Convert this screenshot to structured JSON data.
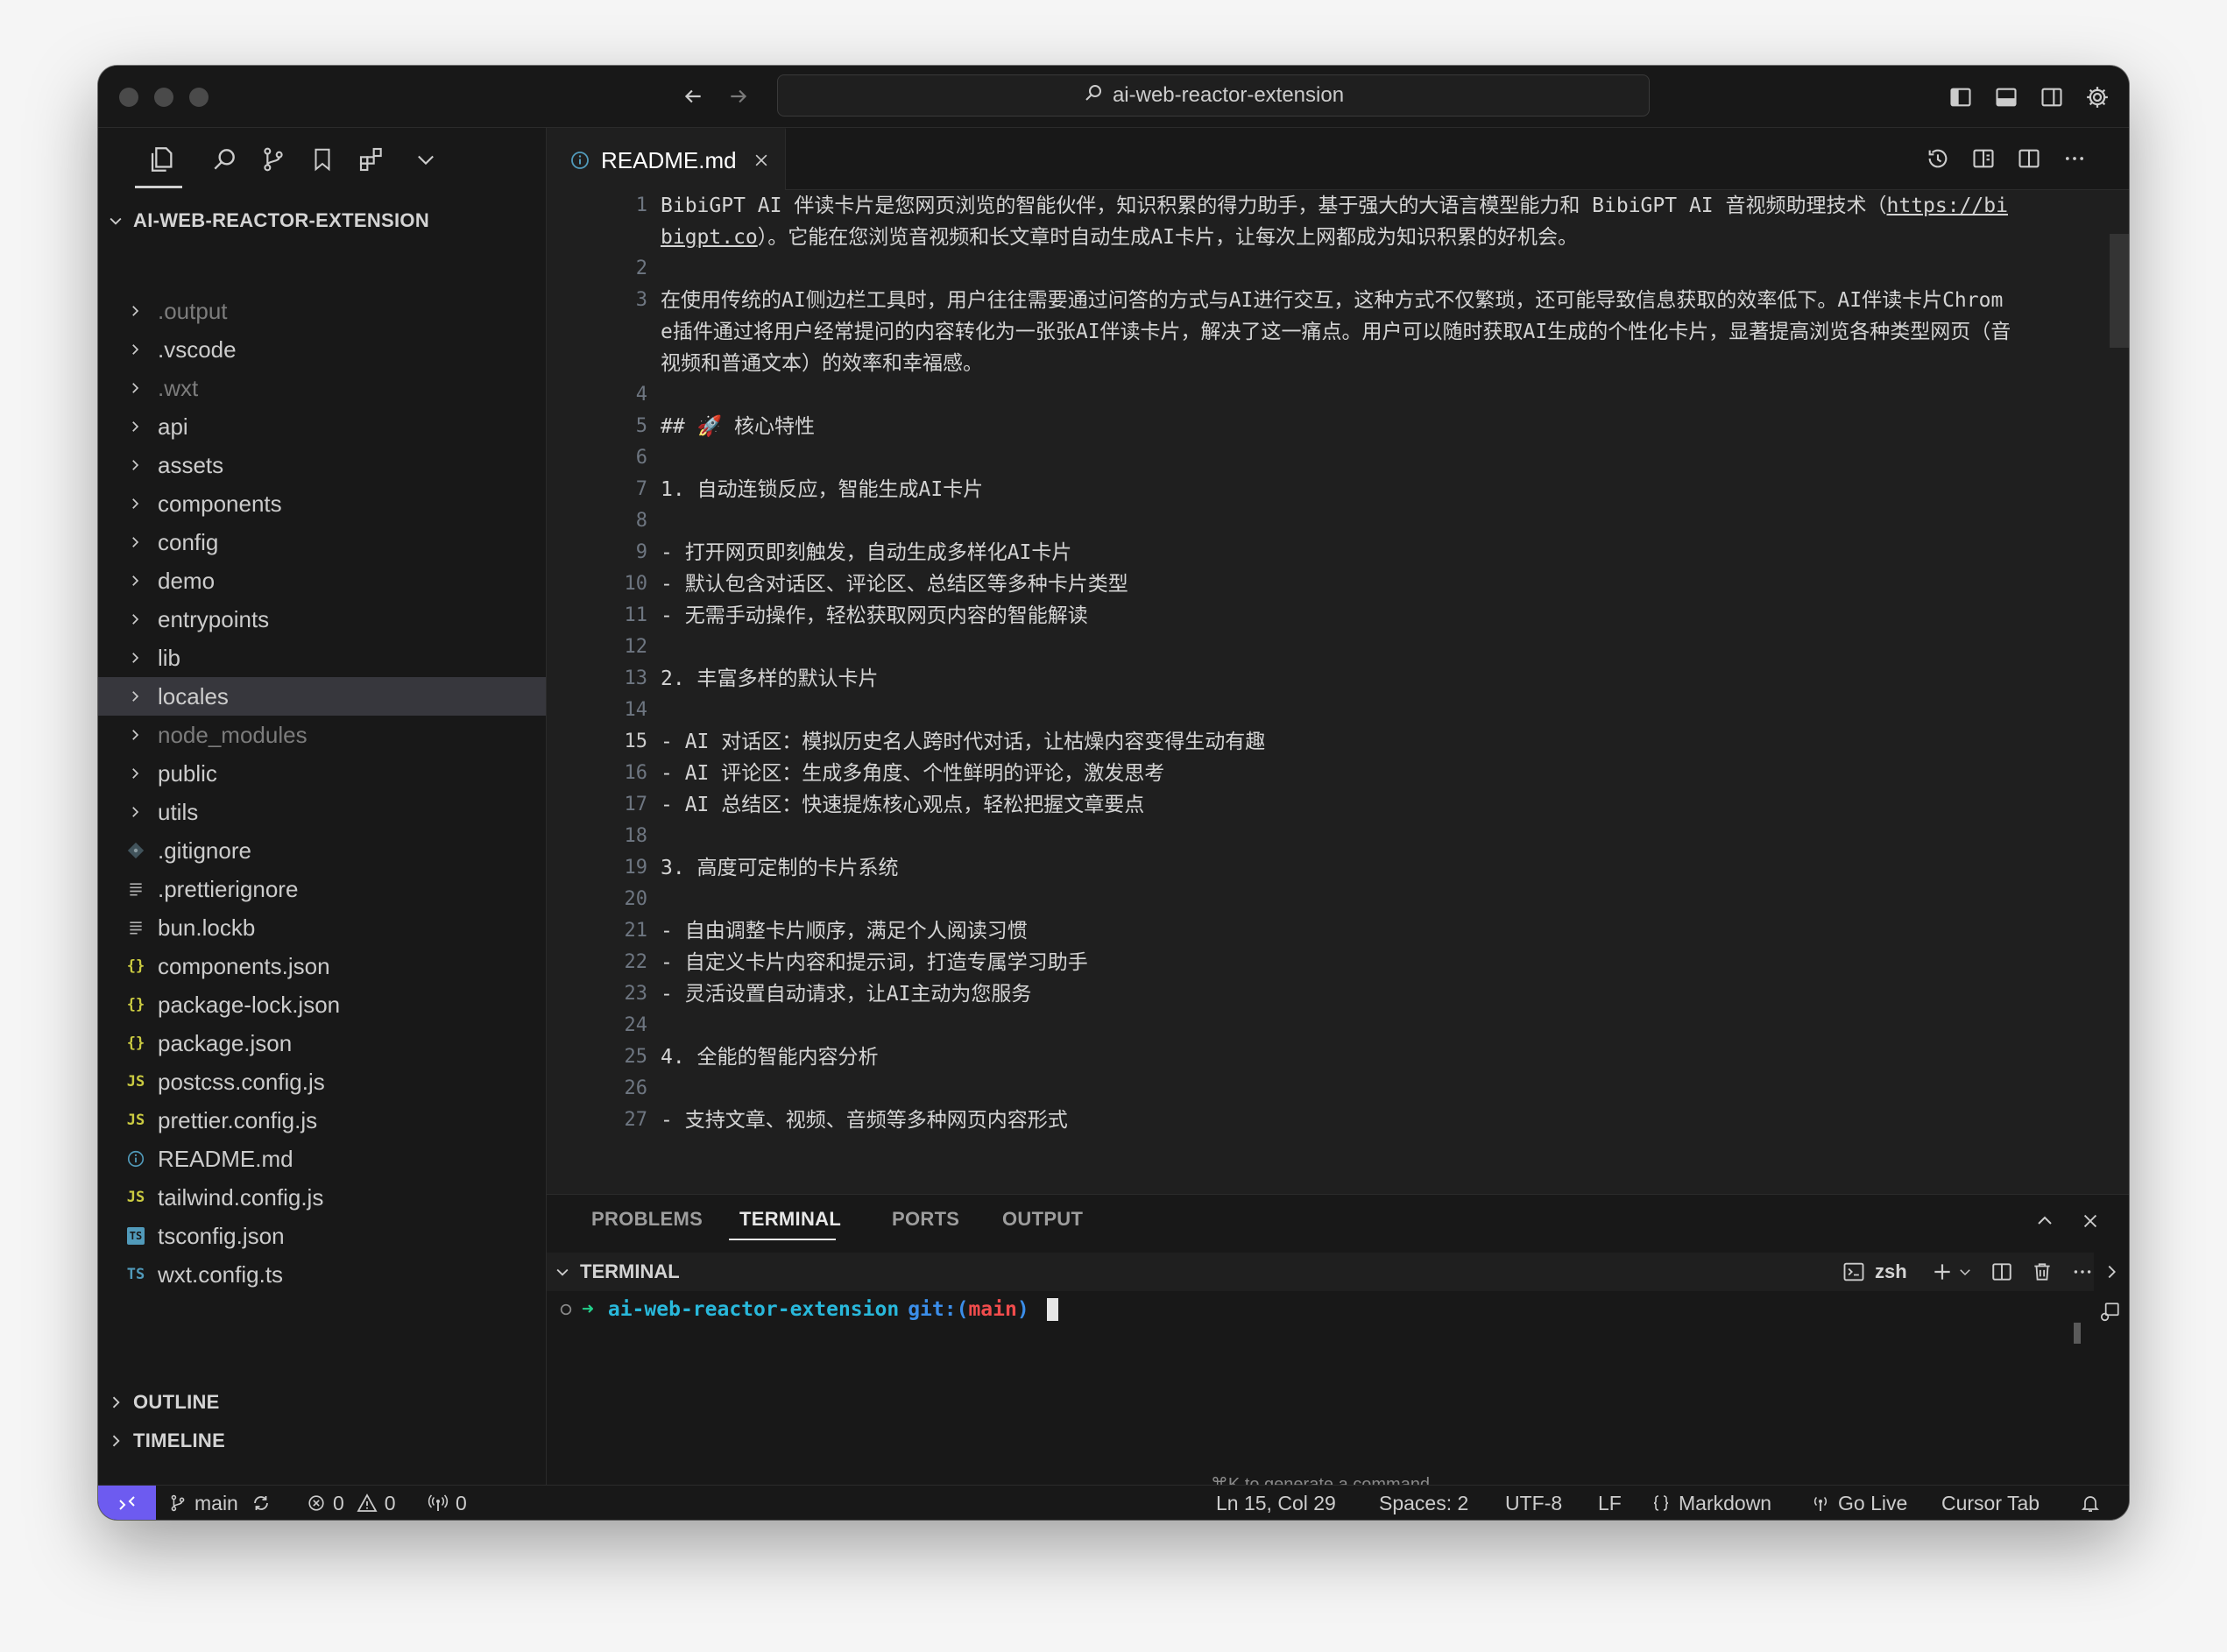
{
  "window": {
    "search_title": "ai-web-reactor-extension"
  },
  "explorer": {
    "root_label": "AI-WEB-REACTOR-EXTENSION",
    "items": [
      {
        "label": ".output",
        "type": "folder",
        "dim": true
      },
      {
        "label": ".vscode",
        "type": "folder"
      },
      {
        "label": ".wxt",
        "type": "folder",
        "dim": true
      },
      {
        "label": "api",
        "type": "folder"
      },
      {
        "label": "assets",
        "type": "folder"
      },
      {
        "label": "components",
        "type": "folder"
      },
      {
        "label": "config",
        "type": "folder"
      },
      {
        "label": "demo",
        "type": "folder"
      },
      {
        "label": "entrypoints",
        "type": "folder"
      },
      {
        "label": "lib",
        "type": "folder"
      },
      {
        "label": "locales",
        "type": "folder",
        "selected": true
      },
      {
        "label": "node_modules",
        "type": "folder",
        "dim": true
      },
      {
        "label": "public",
        "type": "folder"
      },
      {
        "label": "utils",
        "type": "folder"
      },
      {
        "label": ".gitignore",
        "type": "git"
      },
      {
        "label": ".prettierignore",
        "type": "lines"
      },
      {
        "label": "bun.lockb",
        "type": "lines"
      },
      {
        "label": "components.json",
        "type": "json"
      },
      {
        "label": "package-lock.json",
        "type": "json"
      },
      {
        "label": "package.json",
        "type": "json"
      },
      {
        "label": "postcss.config.js",
        "type": "js"
      },
      {
        "label": "prettier.config.js",
        "type": "js"
      },
      {
        "label": "README.md",
        "type": "info"
      },
      {
        "label": "tailwind.config.js",
        "type": "js"
      },
      {
        "label": "tsconfig.json",
        "type": "tsjson"
      },
      {
        "label": "wxt.config.ts",
        "type": "ts"
      }
    ],
    "outline_label": "OUTLINE",
    "timeline_label": "TIMELINE"
  },
  "icon_glyphs": {
    "json": "{}",
    "js": "JS",
    "ts": "TS",
    "tsjson": "TS"
  },
  "editor": {
    "tab_label": "README.md",
    "active_line": 15,
    "lines": [
      {
        "n": "1",
        "segments": [
          {
            "t": "BibiGPT AI 伴读卡片是您网页浏览的智能伙伴，知识积累的得力助手，基于强大的大语言模型能力和 BibiGPT AI 音视频助理技术（"
          },
          {
            "t": "https://bibigpt.co",
            "link": true
          },
          {
            "t": "）。它能在您浏览音视频和长文章时自动生成AI卡片，让每次上网都成为知识积累的好机会。"
          }
        ],
        "rows": 2
      },
      {
        "n": "2",
        "segments": [
          {
            "t": ""
          }
        ]
      },
      {
        "n": "3",
        "segments": [
          {
            "t": "在使用传统的AI侧边栏工具时，用户往往需要通过问答的方式与AI进行交互，这种方式不仅繁琐，还可能导致信息获取的效率低下。AI伴读卡片Chrome插件通过将用户经常提问的内容转化为一张张AI伴读卡片，解决了这一痛点。用户可以随时获取AI生成的个性化卡片，显著提高浏览各种类型网页（音视频和普通文本）的效率和幸福感。"
          }
        ],
        "rows": 3
      },
      {
        "n": "4",
        "segments": [
          {
            "t": ""
          }
        ]
      },
      {
        "n": "5",
        "segments": [
          {
            "t": "## 🚀 核心特性"
          }
        ]
      },
      {
        "n": "6",
        "segments": [
          {
            "t": ""
          }
        ]
      },
      {
        "n": "7",
        "segments": [
          {
            "t": "1. 自动连锁反应，智能生成AI卡片"
          }
        ]
      },
      {
        "n": "8",
        "segments": [
          {
            "t": ""
          }
        ]
      },
      {
        "n": "9",
        "segments": [
          {
            "t": "- 打开网页即刻触发，自动生成多样化AI卡片"
          }
        ]
      },
      {
        "n": "10",
        "segments": [
          {
            "t": "- 默认包含对话区、评论区、总结区等多种卡片类型"
          }
        ]
      },
      {
        "n": "11",
        "segments": [
          {
            "t": "- 无需手动操作，轻松获取网页内容的智能解读"
          }
        ]
      },
      {
        "n": "12",
        "segments": [
          {
            "t": ""
          }
        ]
      },
      {
        "n": "13",
        "segments": [
          {
            "t": "2. 丰富多样的默认卡片"
          }
        ]
      },
      {
        "n": "14",
        "segments": [
          {
            "t": ""
          }
        ]
      },
      {
        "n": "15",
        "segments": [
          {
            "t": "- AI 对话区：模拟历史名人跨时代对话，让枯燥内容变得生动有趣"
          }
        ]
      },
      {
        "n": "16",
        "segments": [
          {
            "t": "- AI 评论区：生成多角度、个性鲜明的评论，激发思考"
          }
        ]
      },
      {
        "n": "17",
        "segments": [
          {
            "t": "- AI 总结区：快速提炼核心观点，轻松把握文章要点"
          }
        ]
      },
      {
        "n": "18",
        "segments": [
          {
            "t": ""
          }
        ]
      },
      {
        "n": "19",
        "segments": [
          {
            "t": "3. 高度可定制的卡片系统"
          }
        ]
      },
      {
        "n": "20",
        "segments": [
          {
            "t": ""
          }
        ]
      },
      {
        "n": "21",
        "segments": [
          {
            "t": "- 自由调整卡片顺序，满足个人阅读习惯"
          }
        ]
      },
      {
        "n": "22",
        "segments": [
          {
            "t": "- 自定义卡片内容和提示词，打造专属学习助手"
          }
        ]
      },
      {
        "n": "23",
        "segments": [
          {
            "t": "- 灵活设置自动请求，让AI主动为您服务"
          }
        ]
      },
      {
        "n": "24",
        "segments": [
          {
            "t": ""
          }
        ]
      },
      {
        "n": "25",
        "segments": [
          {
            "t": "4. 全能的智能内容分析"
          }
        ]
      },
      {
        "n": "26",
        "segments": [
          {
            "t": ""
          }
        ]
      },
      {
        "n": "27",
        "segments": [
          {
            "t": "- 支持文章、视频、音频等多种网页内容形式"
          }
        ]
      }
    ]
  },
  "panel": {
    "tabs": [
      "PROBLEMS",
      "TERMINAL",
      "PORTS",
      "OUTPUT"
    ],
    "active_tab": "TERMINAL",
    "terminal_section": "TERMINAL",
    "shell": "zsh",
    "prompt_arrow": "➜",
    "prompt_dir": "ai-web-reactor-extension",
    "prompt_git": "git:(",
    "prompt_branch": "main",
    "prompt_git_close": ")",
    "hint": "⌘K to generate a command"
  },
  "status": {
    "branch": "main",
    "errors": "0",
    "warnings": "0",
    "ports": "0",
    "cursor_pos": "Ln 15, Col 29",
    "spaces": "Spaces: 2",
    "encoding": "UTF-8",
    "eol": "LF",
    "language": "Markdown",
    "go_live": "Go Live",
    "cursor_tab": "Cursor Tab"
  },
  "colors": {
    "accent": "#6d5bf0",
    "prompt_arrow": "#23d18b",
    "prompt_dir": "#29b8db",
    "prompt_git": "#3b8eea",
    "prompt_branch": "#f14c4c",
    "json_icon": "#cbcb41",
    "js_icon": "#cbcb41",
    "ts_icon": "#519aba",
    "info_icon": "#519aba"
  }
}
